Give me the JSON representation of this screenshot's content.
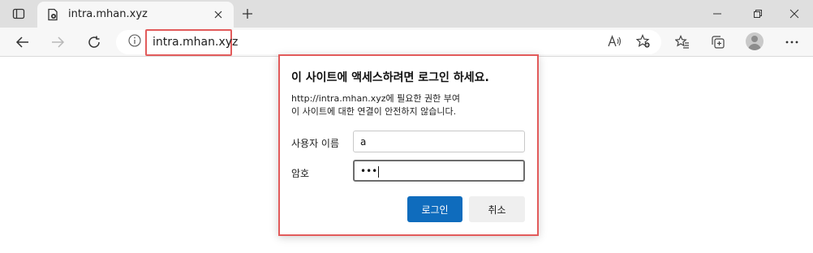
{
  "tab": {
    "title": "intra.mhan.xyz"
  },
  "address_bar": {
    "url": "intra.mhan.xyz"
  },
  "dialog": {
    "title": "이 사이트에 액세스하려면 로그인 하세요.",
    "message_line1": "http://intra.mhan.xyz에 필요한 권한 부여",
    "message_line2": "이 사이트에 대한 연결이 안전하지 않습니다.",
    "username_label": "사용자 이름",
    "username_value": "a",
    "password_label": "암호",
    "password_masked": "•••",
    "login_button": "로그인",
    "cancel_button": "취소"
  },
  "colors": {
    "accent": "#0f6cbd",
    "highlight": "#e25b5b",
    "tabbar": "#dfdfdf",
    "toolbar": "#f7f7f7"
  },
  "icons": [
    "tab-actions-icon",
    "page-favicon-icon",
    "close-tab-icon",
    "new-tab-icon",
    "minimize-icon",
    "maximize-icon",
    "close-window-icon",
    "back-icon",
    "forward-icon",
    "refresh-icon",
    "info-icon",
    "read-aloud-icon",
    "add-favorite-icon",
    "favorites-icon",
    "collections-icon",
    "profile-avatar-icon",
    "more-icon"
  ]
}
